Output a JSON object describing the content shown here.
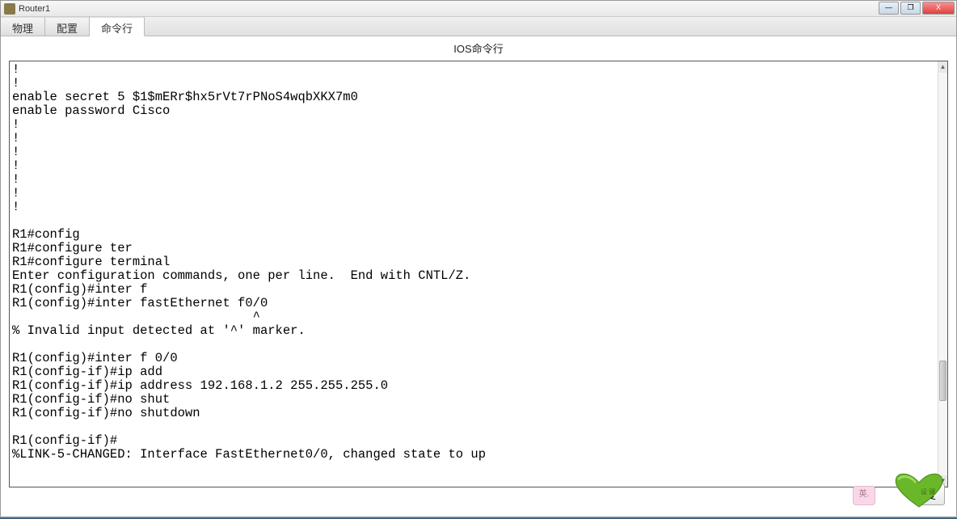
{
  "window": {
    "title": "Router1"
  },
  "tabs": {
    "physical": "物理",
    "config": "配置",
    "cli": "命令行"
  },
  "ios_title": "IOS命令行",
  "terminal_text": "!\n!\nenable secret 5 $1$mERr$hx5rVt7rPNoS4wqbXKX7m0\nenable password Cisco\n!\n!\n!\n!\n!\n!\n!\n\nR1#config\nR1#configure ter\nR1#configure terminal\nEnter configuration commands, one per line.  End with CNTL/Z.\nR1(config)#inter f\nR1(config)#inter fastEthernet f0/0\n                                ^\n% Invalid input detected at '^' marker.\n\nR1(config)#inter f 0/0\nR1(config-if)#ip add\nR1(config-if)#ip address 192.168.1.2 255.255.255.0\nR1(config-if)#no shut\nR1(config-if)#no shutdown\n\nR1(config-if)#\n%LINK-5-CHANGED: Interface FastEthernet0/0, changed state to up",
  "buttons": {
    "copy": "复",
    "minimize": "—",
    "maximize": "❐",
    "close": "X"
  },
  "ime": "英.",
  "caret_hint": "^"
}
